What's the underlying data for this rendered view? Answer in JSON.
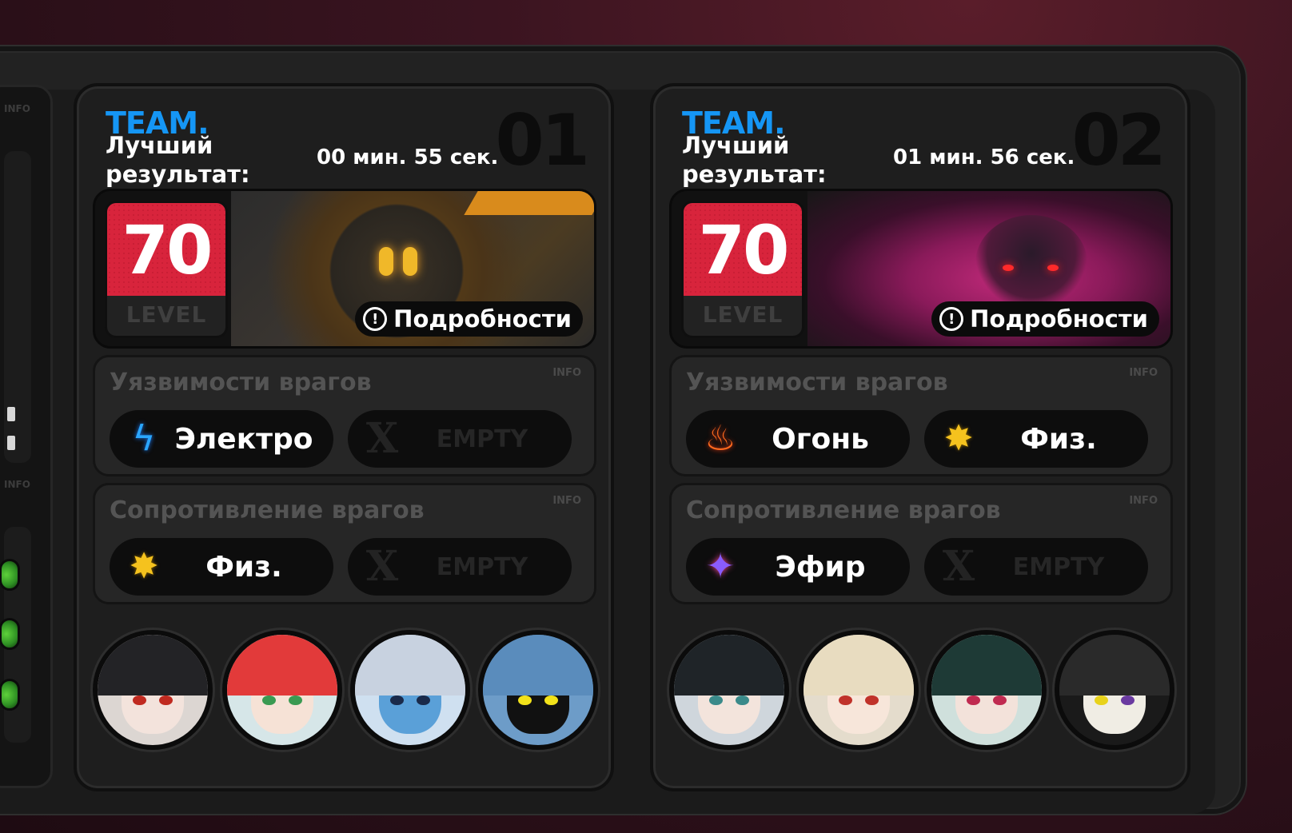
{
  "teams": [
    {
      "team_label": "TEAM.",
      "best_label": "Лучший результат:",
      "best_time": "00 мин.  55 сек.",
      "number": "01",
      "level": {
        "value": "70",
        "label": "LEVEL"
      },
      "details_label": "Подробности",
      "weaknesses": {
        "title": "Уязвимости врагов",
        "info": "INFO",
        "items": [
          {
            "icon": "electro-icon",
            "label": "Электро"
          },
          {
            "icon": "empty-x-icon",
            "label": "EMPTY"
          }
        ]
      },
      "resistances": {
        "title": "Сопротивление врагов",
        "info": "INFO",
        "items": [
          {
            "icon": "physical-icon",
            "label": "Физ."
          },
          {
            "icon": "empty-x-icon",
            "label": "EMPTY"
          }
        ]
      },
      "avatars": [
        "agent-avatar",
        "agent-avatar",
        "agent-avatar",
        "agent-avatar"
      ]
    },
    {
      "team_label": "TEAM.",
      "best_label": "Лучший результат:",
      "best_time": "01 мин.  56 сек.",
      "number": "02",
      "level": {
        "value": "70",
        "label": "LEVEL"
      },
      "details_label": "Подробности",
      "weaknesses": {
        "title": "Уязвимости врагов",
        "info": "INFO",
        "items": [
          {
            "icon": "fire-icon",
            "label": "Огонь"
          },
          {
            "icon": "physical-icon",
            "label": "Физ."
          }
        ]
      },
      "resistances": {
        "title": "Сопротивление врагов",
        "info": "INFO",
        "items": [
          {
            "icon": "ether-icon",
            "label": "Эфир"
          },
          {
            "icon": "empty-x-icon",
            "label": "EMPTY"
          }
        ]
      },
      "avatars": [
        "agent-avatar",
        "agent-avatar",
        "agent-avatar",
        "agent-avatar"
      ]
    }
  ],
  "side_panel": {
    "info_top": "INFO",
    "info_bottom": "INFO"
  },
  "colors": {
    "team_blue": "#1596f5",
    "level_red": "#d8243c",
    "electro": "#2aa6ff",
    "fire": "#ff6a1e",
    "physical": "#f5c21e",
    "ether": "#8a5cff"
  }
}
